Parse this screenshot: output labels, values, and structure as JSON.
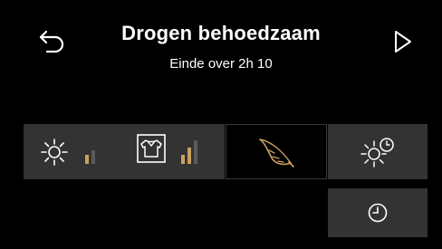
{
  "header": {
    "title": "Drogen behoedzaam",
    "subtitle": "Einde over 2h 10"
  },
  "icons": {
    "back": "back-arrow-icon",
    "start": "play-icon",
    "drying_level": "sun-icon",
    "ironing": "shirt-icon",
    "gentle": "feather-icon",
    "delay_start": "sun-clock-icon",
    "timer": "clock-icon"
  },
  "level_indicators": {
    "drying_level": 1,
    "ironing_level": 2,
    "max": 3
  },
  "colors": {
    "background": "#000000",
    "tile": "#333333",
    "accent_gold": "#c9a15f",
    "inactive_bar": "#5b5b5b"
  }
}
